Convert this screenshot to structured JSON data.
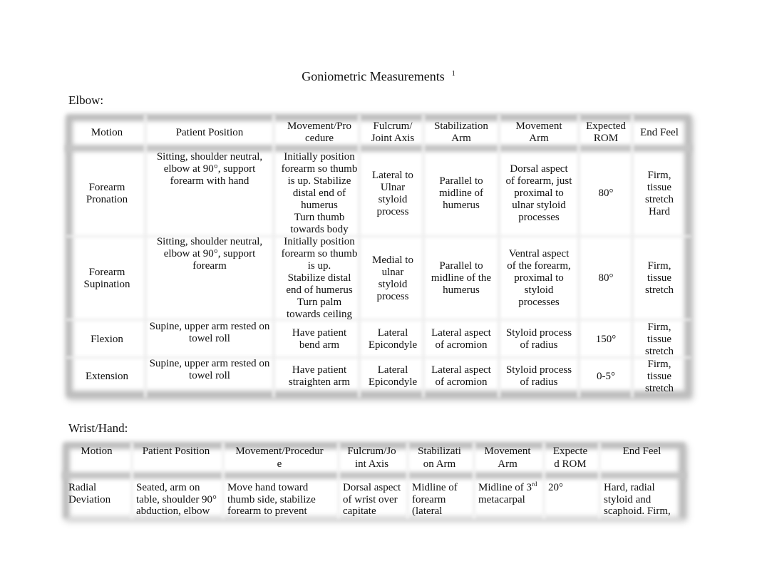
{
  "document": {
    "title": "Goniometric Measurements",
    "footnote_marker": "1"
  },
  "elbow": {
    "section_label": "Elbow:",
    "headers": [
      "Motion",
      "Patient Position",
      "Movement/Pro\ncedure",
      "Fulcrum/\nJoint Axis",
      "Stabilization\nArm",
      "Movement\nArm",
      "Expected\nROM",
      "End Feel"
    ],
    "rows": [
      {
        "motion": "Forearm\nPronation",
        "patient_position": "Sitting, shoulder neutral,\nelbow at 90°, support\nforearm with hand",
        "movement_procedure": "Initially position\nforearm so thumb\nis up. Stabilize\ndistal end of\nhumerus\nTurn thumb\ntowards body",
        "fulcrum": "Lateral to\nUlnar\nstyloid\nprocess",
        "stabilization_arm": "Parallel to\nmidline of\nhumerus",
        "movement_arm": "Dorsal aspect\nof forearm, just\nproximal to\nulnar styloid\nprocesses",
        "expected_rom": "80°",
        "end_feel": "Firm,\ntissue\nstretch\nHard"
      },
      {
        "motion": "Forearm\nSupination",
        "patient_position": "Sitting, shoulder neutral,\nelbow at 90°, support\nforearm",
        "movement_procedure": "Initially position\nforearm so thumb\nis up.\nStabilize distal\nend of humerus\nTurn palm\ntowards ceiling",
        "fulcrum": "Medial to\nulnar\nstyloid\nprocess",
        "stabilization_arm": "Parallel to\nmidline of the\nhumerus",
        "movement_arm": "Ventral aspect\nof the forearm,\nproximal to\nstyloid\nprocesses",
        "expected_rom": "80°",
        "end_feel": "Firm,\ntissue\nstretch"
      },
      {
        "motion": "Flexion",
        "patient_position": "Supine, upper arm rested on\ntowel roll",
        "movement_procedure": "Have patient\nbend arm",
        "fulcrum": "Lateral\nEpicondyle",
        "stabilization_arm": "Lateral aspect\nof acromion",
        "movement_arm": "Styloid process\nof radius",
        "expected_rom": "150°",
        "end_feel": "Firm,\ntissue\nstretch"
      },
      {
        "motion": "Extension",
        "patient_position": "Supine, upper arm rested on\ntowel roll",
        "movement_procedure": "Have patient\nstraighten arm",
        "fulcrum": "Lateral\nEpicondyle",
        "stabilization_arm": "Lateral aspect\nof acromion",
        "movement_arm": "Styloid process\nof radius",
        "expected_rom": "0-5°",
        "end_feel": "Firm,\ntissue\nstretch"
      }
    ]
  },
  "wrist_hand": {
    "section_label": "Wrist/Hand:",
    "headers": [
      "Motion",
      "Patient Position",
      "Movement/Procedur\ne",
      "Fulcrum/Jo\nint Axis",
      "Stabilizati\non Arm",
      "Movement\nArm",
      "Expecte\nd ROM",
      "End Feel"
    ],
    "rows": [
      {
        "motion": "Radial\nDeviation",
        "patient_position": "Seated, arm on\ntable, shoulder 90°\nabduction, elbow",
        "movement_procedure": "Move hand toward\nthumb side, stabilize\nforearm to prevent",
        "fulcrum": "Dorsal aspect\nof wrist over\ncapitate",
        "stabilization_arm": "Midline of\nforearm\n(lateral",
        "movement_arm_prefix": "Midline of 3",
        "movement_arm_sup": "rd",
        "movement_arm_suffix": "\nmetacarpal",
        "expected_rom": "20°",
        "end_feel": "Hard, radial\nstyloid and\nscaphoid. Firm,"
      }
    ]
  }
}
